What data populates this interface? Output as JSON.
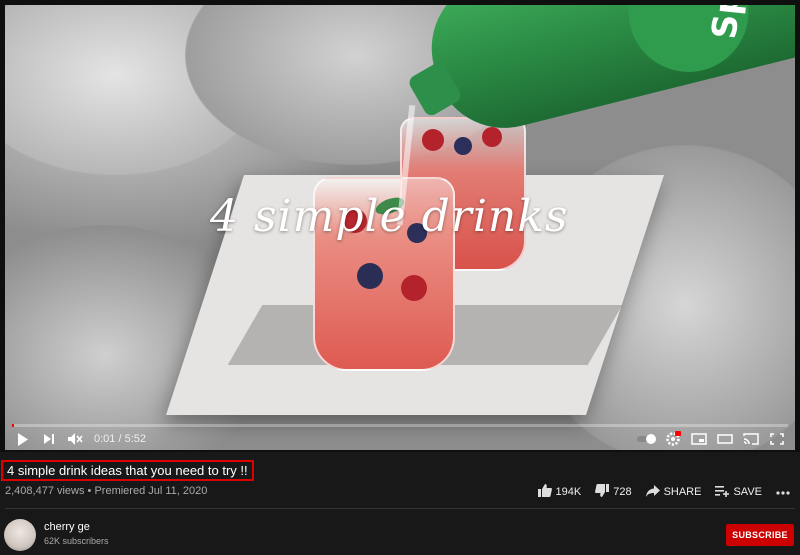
{
  "video": {
    "overlay_title": "4 simple drinks",
    "progress_fraction": 0.003,
    "current_time": "0:01",
    "duration": "5:52",
    "time_display": "0:01 / 5:52"
  },
  "info": {
    "title": "4 simple drink ideas that you need to try !!",
    "views_date": "2,408,477 views • Premiered Jul 11, 2020",
    "likes": "194K",
    "dislikes": "728",
    "share_label": "SHARE",
    "save_label": "SAVE"
  },
  "channel": {
    "name": "cherry ge",
    "subscribers": "62K subscribers",
    "subscribe_label": "SUBSCRIBE"
  },
  "icons": [
    "play-icon",
    "next-icon",
    "mute-icon",
    "autoplay-toggle-icon",
    "settings-icon",
    "miniplayer-icon",
    "theater-icon",
    "cast-icon",
    "fullscreen-icon",
    "like-icon",
    "dislike-icon",
    "share-icon",
    "save-icon",
    "more-icon"
  ],
  "colors": {
    "accent": "#ff0000",
    "subscribe_bg": "#cc0000",
    "background": "#181818"
  }
}
